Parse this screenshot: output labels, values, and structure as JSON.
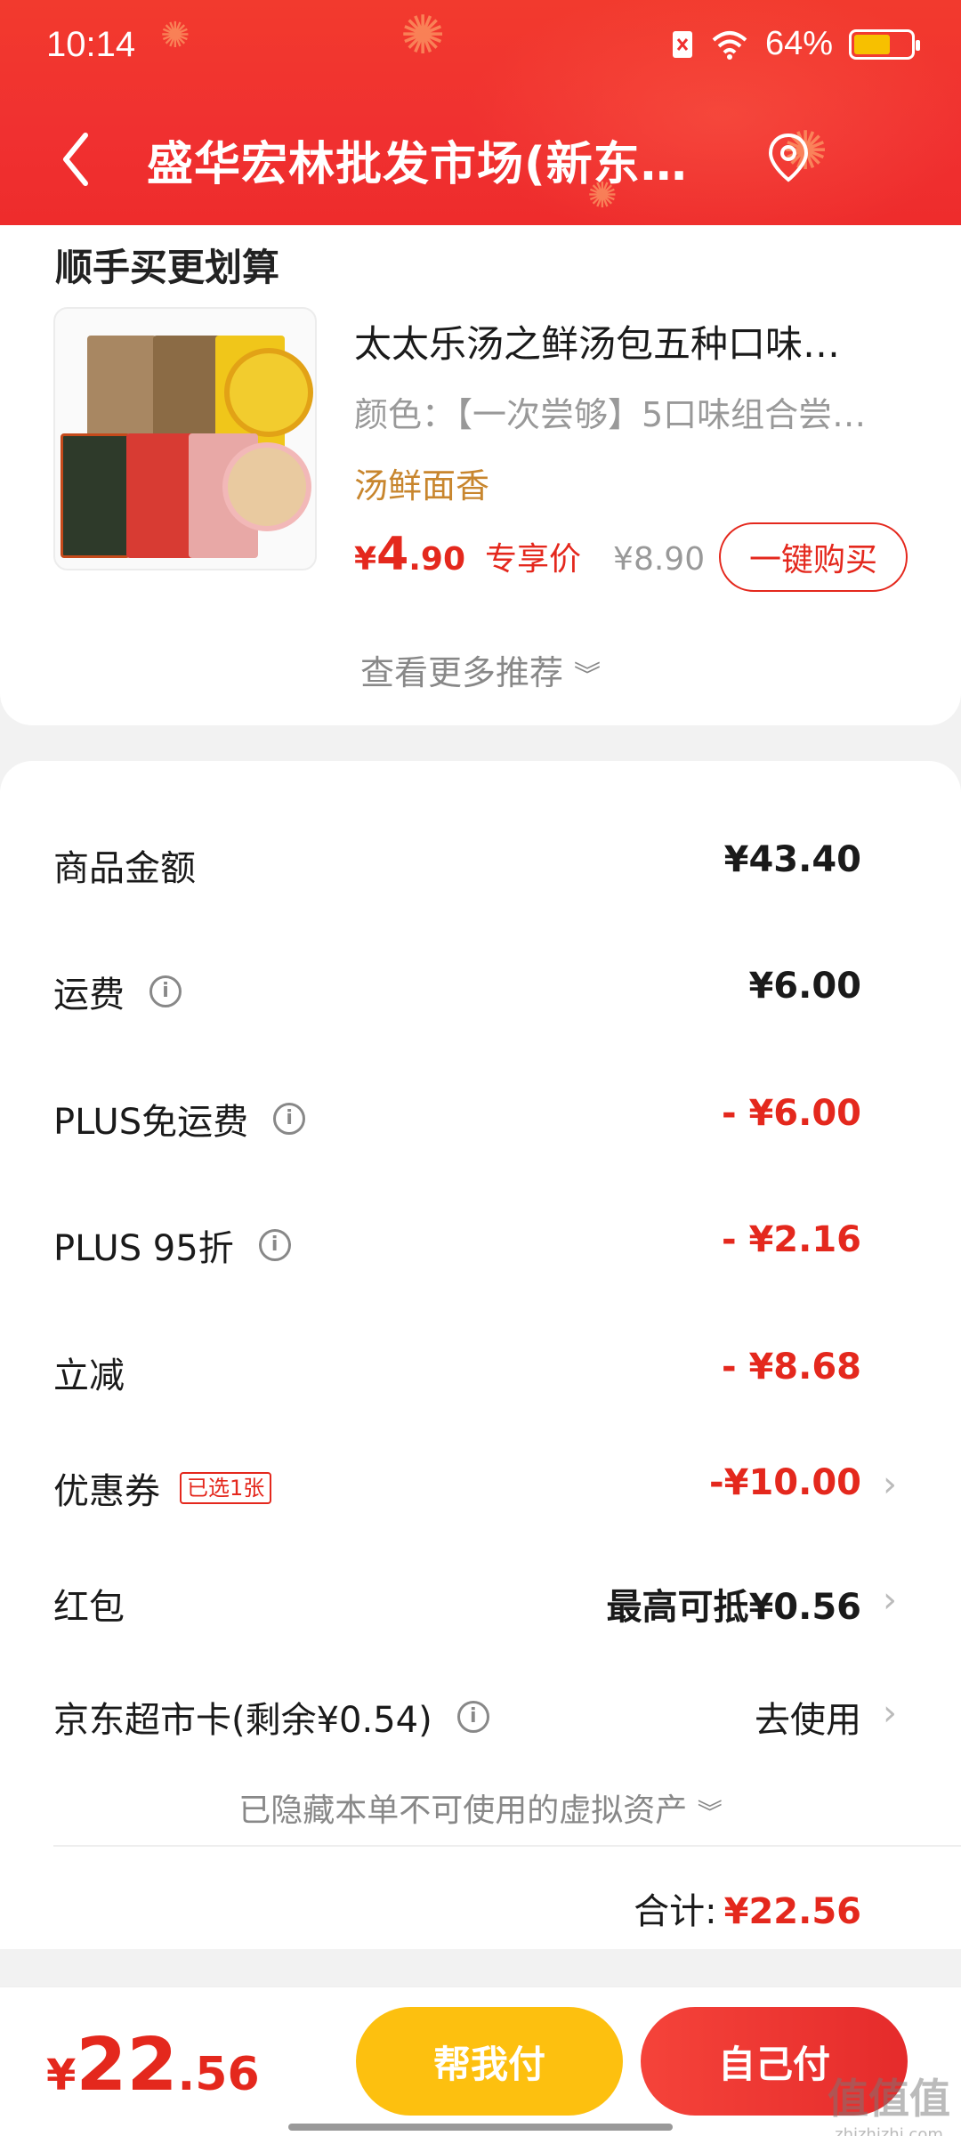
{
  "statusbar": {
    "time": "10:14",
    "battery": "64%",
    "battery_level": 0.64
  },
  "nav": {
    "title": "盛华宏林批发市场(新东…"
  },
  "card1": {
    "section_title": "顺手买更划算",
    "product": {
      "name": "太太乐汤之鲜汤包五种口味…",
      "spec": "颜色：【一次尝够】5口味组合尝…",
      "tag": "汤鲜面香",
      "price_currency": "¥",
      "price_int": "4",
      "price_dec": ".90",
      "price_label": "专享价",
      "original_price": "¥8.90",
      "buy_label": "一键购买"
    },
    "more_label": "查看更多推荐"
  },
  "summary": {
    "rows": [
      {
        "label": "商品金额",
        "value": "¥43.40"
      },
      {
        "label": "运费",
        "value": "¥6.00"
      },
      {
        "label": "PLUS免运费",
        "value": "- ¥6.00"
      },
      {
        "label": "PLUS 95折",
        "value": "- ¥2.16"
      },
      {
        "label": "立减",
        "value": "- ¥8.68"
      },
      {
        "label": "优惠券",
        "badge": "已选1张",
        "value": "-¥10.00"
      },
      {
        "label": "红包",
        "value": "最高可抵¥0.56"
      },
      {
        "label": "京东超市卡(剩余¥0.54)",
        "value": "去使用"
      }
    ],
    "hidden_assets": "已隐藏本单不可使用的虚拟资产",
    "total_label": "合计:",
    "total_value": "¥22.56"
  },
  "footer": {
    "currency": "¥",
    "int": "22",
    "dec": ".56",
    "help_pay": "帮我付",
    "self_pay": "自己付"
  },
  "watermark": {
    "main": "值值值",
    "sub": "zhizhizhi.com"
  },
  "colors": {
    "accent": "#e4281d",
    "header": "#f03030",
    "help_btn": "#fdc00f"
  }
}
